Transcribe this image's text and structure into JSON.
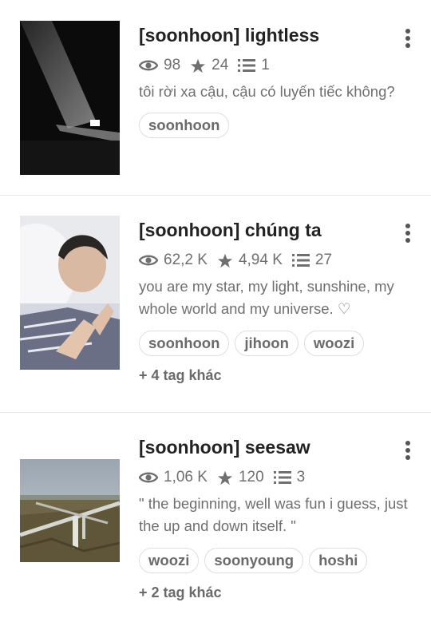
{
  "stories": [
    {
      "title": "[soonhoon] lightless",
      "reads": "98",
      "votes": "24",
      "parts": "1",
      "description": "tôi rời xa cậu, cậu có luyến tiếc không?",
      "tags": [
        "soonhoon"
      ],
      "more_tags": ""
    },
    {
      "title": "[soonhoon] chúng ta",
      "reads": "62,2 K",
      "votes": "4,94 K",
      "parts": "27",
      "description": "you are my star, my light, sunshine, my whole world and my universe. ♡",
      "tags": [
        "soonhoon",
        "jihoon",
        "woozi"
      ],
      "more_tags": "+ 4 tag khác"
    },
    {
      "title": "[soonhoon] seesaw",
      "reads": "1,06 K",
      "votes": "120",
      "parts": "3",
      "description": "\" the beginning, well was fun i guess, just the up and down itself. \"",
      "tags": [
        "woozi",
        "soonyoung",
        "hoshi"
      ],
      "more_tags": "+ 2 tag khác"
    }
  ],
  "icons": {
    "reads": "eye-icon",
    "votes": "star-icon",
    "parts": "list-icon",
    "menu": "more-vertical-icon"
  },
  "colors": {
    "meta": "#6f6f6f",
    "title": "#222222",
    "tag_border": "#dedede",
    "divider": "#e6e6e6"
  }
}
